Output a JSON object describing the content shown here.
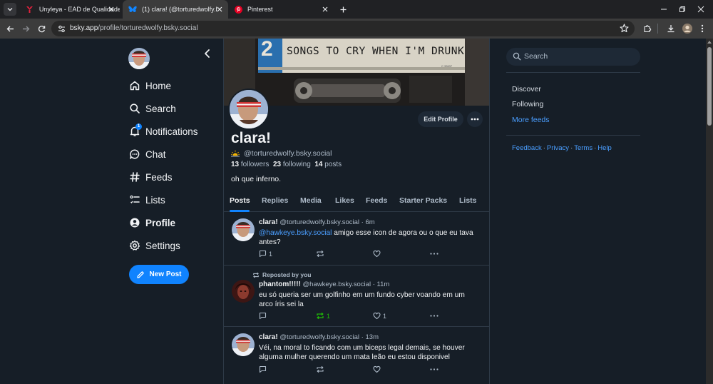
{
  "browser": {
    "tabs": [
      {
        "title": "Unyleya - EAD de Qualidade",
        "icon": "unyleya-favicon"
      },
      {
        "title": "(1) clara! (@torturedwolfy.bsky.social",
        "icon": "bluesky-butterfly"
      },
      {
        "title": "Pinterest",
        "icon": "pinterest-favicon"
      }
    ],
    "url_host": "bsky.app",
    "url_path": "/profile/torturedwolfy.bsky.social"
  },
  "sidebar": {
    "items": [
      {
        "label": "Home",
        "icon": "home-icon"
      },
      {
        "label": "Search",
        "icon": "search-icon"
      },
      {
        "label": "Notifications",
        "icon": "bell-icon",
        "badge": "1"
      },
      {
        "label": "Chat",
        "icon": "chat-icon"
      },
      {
        "label": "Feeds",
        "icon": "hash-icon"
      },
      {
        "label": "Lists",
        "icon": "list-icon"
      },
      {
        "label": "Profile",
        "icon": "profile-icon"
      },
      {
        "label": "Settings",
        "icon": "gear-icon"
      }
    ],
    "new_post": "New Post"
  },
  "profile": {
    "banner_number": "2",
    "banner_text": "SONGS TO CRY WHEN I'M DRUNK",
    "banner_code": "C 33637",
    "edit_label": "Edit Profile",
    "display_name": "clara!",
    "handle": "@torturedwolfy.bsky.social",
    "followers_count": "13",
    "followers_label": "followers",
    "following_count": "23",
    "following_label": "following",
    "posts_count": "14",
    "posts_label": "posts",
    "bio": "oh que inferno."
  },
  "profile_tabs": [
    "Posts",
    "Replies",
    "Media",
    "Likes",
    "Feeds",
    "Starter Packs",
    "Lists"
  ],
  "posts": [
    {
      "author": "clara!",
      "handle": "@torturedwolfy.bsky.social",
      "time": "6m",
      "mention": "@hawkeye.bsky.social",
      "text": " amigo esse icon de agora ou o que eu tava antes?",
      "replies": "1",
      "reposts": "",
      "likes": ""
    },
    {
      "repost_label": "Reposted by you",
      "author": "phantom!!!!!",
      "handle": "@hawkeye.bsky.social",
      "time": "11m",
      "text": "eu só queria ser um golfinho em um fundo cyber voando em um arco íris sei la",
      "replies": "",
      "reposts": "1",
      "likes": "1"
    },
    {
      "author": "clara!",
      "handle": "@torturedwolfy.bsky.social",
      "time": "13m",
      "text": "Véi, na moral to ficando com um biceps legal demais, se houver alguma mulher querendo um mata leão eu estou disponivel",
      "replies": "",
      "reposts": "",
      "likes": ""
    }
  ],
  "right": {
    "search_placeholder": "Search",
    "feeds": [
      "Discover",
      "Following",
      "More feeds"
    ],
    "footer": [
      "Feedback",
      "Privacy",
      "Terms",
      "Help"
    ]
  },
  "colors": {
    "background": "#161e27",
    "accent": "#1083fe",
    "link": "#4a9eff",
    "repost_green": "#20bc07"
  }
}
